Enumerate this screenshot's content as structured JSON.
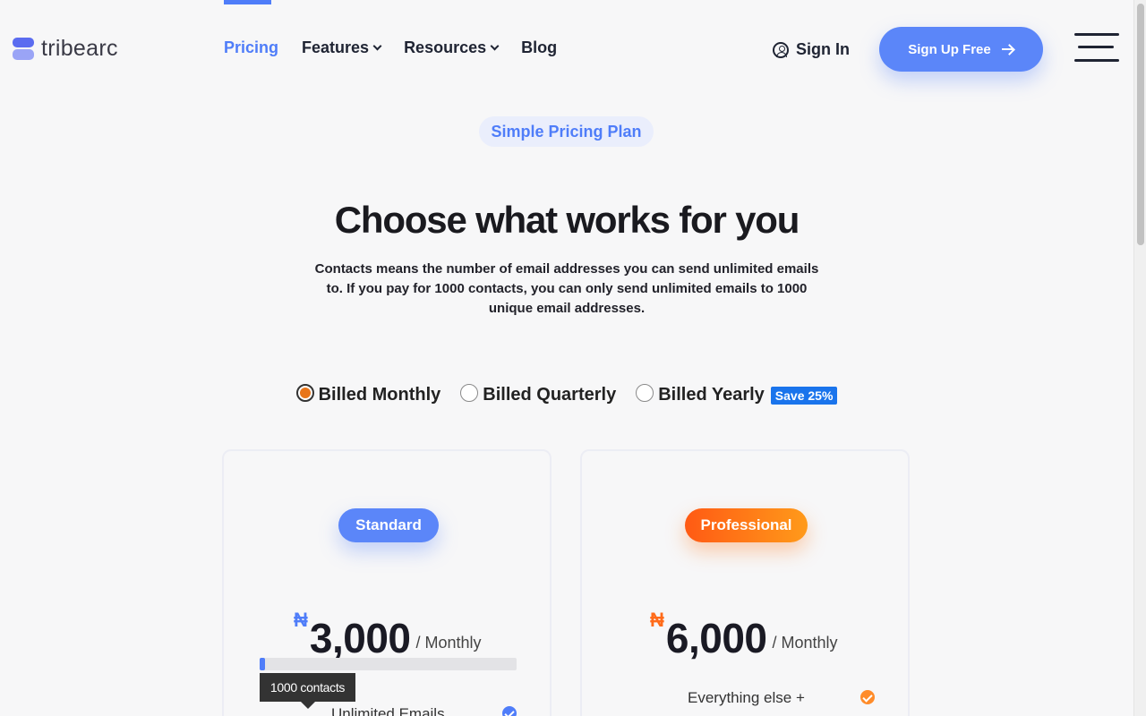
{
  "brand": {
    "name": "tribearc",
    "colors": {
      "primary": "#4f7df9",
      "accent": "#ff6b1a"
    }
  },
  "nav": {
    "items": [
      {
        "label": "Pricing",
        "active": true
      },
      {
        "label": "Features",
        "dropdown": true
      },
      {
        "label": "Resources",
        "dropdown": true
      },
      {
        "label": "Blog"
      }
    ],
    "sign_in": "Sign In",
    "sign_up": "Sign Up Free"
  },
  "hero": {
    "pill": "Simple Pricing Plan",
    "title": "Choose what works for you",
    "description": "Contacts means the number of email addresses you can send unlimited emails to. If you pay for 1000 contacts, you can only send unlimited emails to 1000 unique email addresses."
  },
  "billing": {
    "options": [
      {
        "label": "Billed Monthly",
        "selected": true
      },
      {
        "label": "Billed Quarterly",
        "selected": false
      },
      {
        "label": "Billed Yearly",
        "selected": false
      }
    ],
    "yearly_badge": "Save 25%"
  },
  "plans": [
    {
      "name": "Standard",
      "currency": "₦",
      "price": "3,000",
      "period": "/ Monthly",
      "contacts_tooltip": "1000 contacts",
      "slider_fraction": 0.02,
      "feature": "Unlimited Emails"
    },
    {
      "name": "Professional",
      "currency": "₦",
      "price": "6,000",
      "period": "/ Monthly",
      "feature": "Everything else +"
    }
  ]
}
